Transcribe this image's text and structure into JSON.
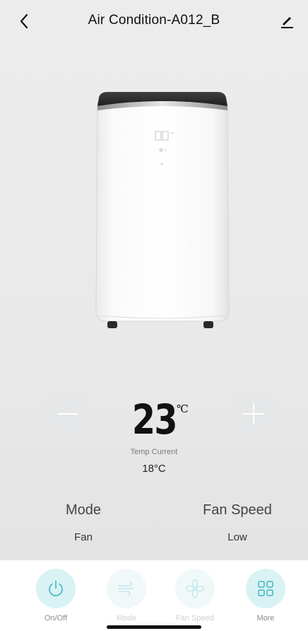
{
  "header": {
    "title": "Air Condition-A012_B",
    "back_icon": "chevron-left-icon",
    "edit_icon": "pencil-icon"
  },
  "temperature": {
    "set_value": "23",
    "unit": "℃",
    "current_label": "Temp Current",
    "current_value": "18°C",
    "decrease_icon": "minus-icon",
    "increase_icon": "plus-icon"
  },
  "status": {
    "mode_title": "Mode",
    "mode_value": "Fan",
    "fan_title": "Fan Speed",
    "fan_value": "Low"
  },
  "tabs": [
    {
      "label": "On/Off",
      "icon": "power-icon",
      "state": "active"
    },
    {
      "label": "Mode",
      "icon": "wind-icon",
      "state": "disabled"
    },
    {
      "label": "Fan Speed",
      "icon": "fan-icon",
      "state": "disabled"
    },
    {
      "label": "More",
      "icon": "grid-icon",
      "state": "active"
    }
  ],
  "colors": {
    "accent": "#3fb6c2",
    "accent_light": "#d9f2f4",
    "background": "#e9e9e9"
  }
}
